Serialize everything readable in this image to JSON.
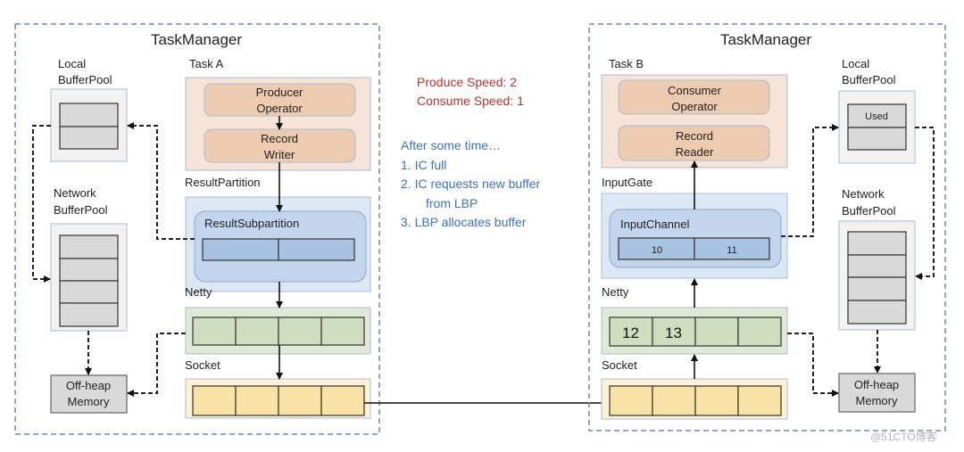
{
  "left_tm": {
    "title": "TaskManager",
    "local_pool": "Local\nBufferPool",
    "local_pool_l1": "Local",
    "local_pool_l2": "BufferPool",
    "task_label": "Task A",
    "operator_l1": "Producer",
    "operator_l2": "Operator",
    "rw_l1": "Record",
    "rw_l2": "Writer",
    "partition_label": "ResultPartition",
    "subpartition_label": "ResultSubpartition",
    "network_pool_l1": "Network",
    "network_pool_l2": "BufferPool",
    "netty_label": "Netty",
    "socket_label": "Socket",
    "offheap_l1": "Off-heap",
    "offheap_l2": "Memory"
  },
  "right_tm": {
    "title": "TaskManager",
    "task_label": "Task B",
    "operator_l1": "Consumer",
    "operator_l2": "Operator",
    "rr_l1": "Record",
    "rr_l2": "Reader",
    "gate_label": "InputGate",
    "channel_label": "InputChannel",
    "channel_buffers": [
      "10",
      "11"
    ],
    "local_pool_l1": "Local",
    "local_pool_l2": "BufferPool",
    "local_used": "Used",
    "network_pool_l1": "Network",
    "network_pool_l2": "BufferPool",
    "netty_label": "Netty",
    "netty_buffers": [
      "12",
      "13",
      "",
      ""
    ],
    "socket_label": "Socket",
    "offheap_l1": "Off-heap",
    "offheap_l2": "Memory"
  },
  "notes": {
    "produce": "Produce Speed:   2",
    "consume": "Consume Speed:  1",
    "after": "After some time…",
    "steps": [
      "1.   IC full",
      "2.   IC requests new buffer",
      "from LBP",
      "3.   LBP allocates buffer"
    ]
  },
  "watermark": "@51CTO博客",
  "colors": {
    "task": "#f5e4d7",
    "operator": "#edcbb0",
    "partition": "#dde8f5",
    "subpartition": "#c2d5ec",
    "buffer_blue": "#a8c2e1",
    "netty": "#e0ead6",
    "netty_cell": "#cfdebf",
    "socket": "#fdf2d5",
    "socket_cell": "#f9e2a6",
    "pool": "#f2f2f2",
    "pool_cell": "#d9d9d9",
    "note_red": "#b8322f",
    "note_blue": "#3b72c0"
  }
}
